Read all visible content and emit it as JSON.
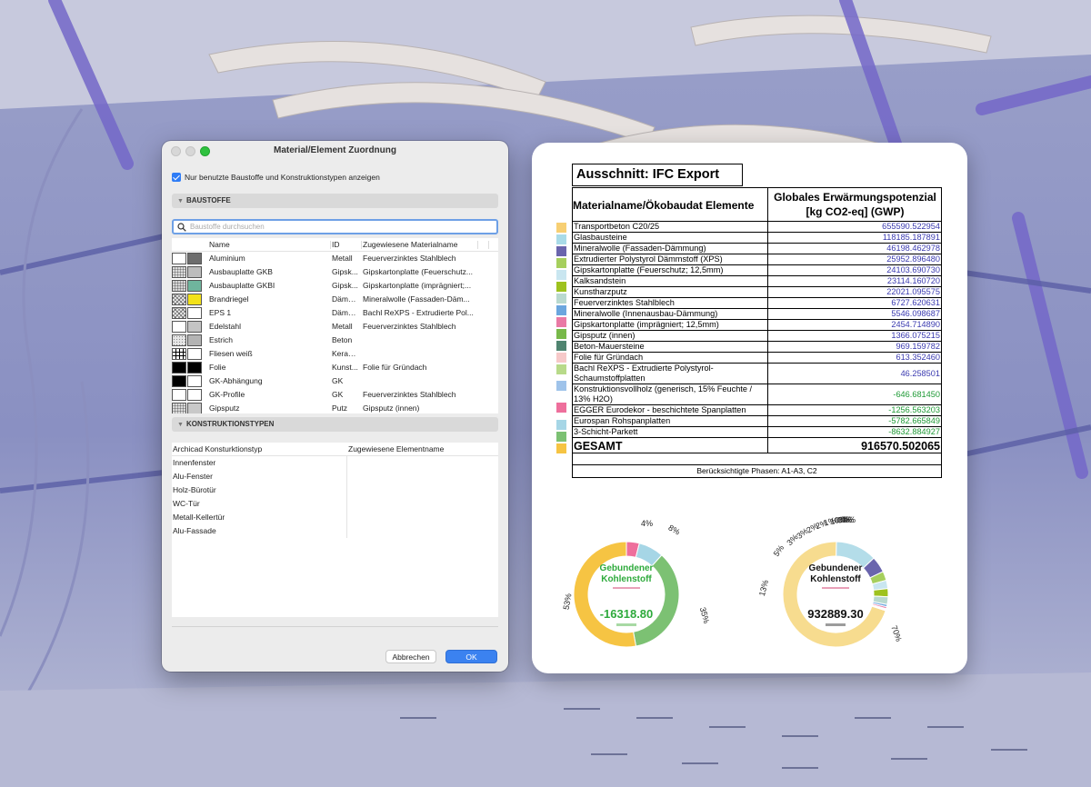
{
  "dialog": {
    "title": "Material/Element Zuordnung",
    "checkbox_label": "Nur benutzte Baustoffe und Konstruktionstypen anzeigen",
    "baustoffe_header": "BAUSTOFFE",
    "search_placeholder": "Baustoffe durchsuchen",
    "columns": {
      "name": "Name",
      "id": "ID",
      "assigned": "Zugewiesene Materialname"
    },
    "materials": [
      {
        "name": "Aluminium",
        "id": "Metall",
        "assigned": "Feuerverzinktes Stahlblech",
        "sw1": "#ffffff",
        "sw2": "#6d6d6d",
        "pattern": "none"
      },
      {
        "name": "Ausbauplatte GKB",
        "id": "Gipsk...",
        "assigned": "Gipskartonplatte (Feuerschutz...",
        "sw1": "#dcdcdc",
        "sw2": "#bcbcbc",
        "pattern": "grid"
      },
      {
        "name": "Ausbauplatte GKBI",
        "id": "Gipsk...",
        "assigned": "Gipskartonplatte (imprägniert;...",
        "sw1": "#d6d6d6",
        "sw2": "#6fb59d",
        "pattern": "grid"
      },
      {
        "name": "Brandriegel",
        "id": "Dämm...",
        "assigned": "Mineralwolle (Fassaden-Däm...",
        "sw1": "#ececec",
        "sw2": "#f3e21a",
        "pattern": "wave"
      },
      {
        "name": "EPS 1",
        "id": "Dämm...",
        "assigned": "Bachl ReXPS - Extrudierte Pol...",
        "sw1": "#ececec",
        "sw2": "#ffffff",
        "pattern": "wave"
      },
      {
        "name": "Edelstahl",
        "id": "Metall",
        "assigned": "Feuerverzinktes Stahlblech",
        "sw1": "#ffffff",
        "sw2": "#c4c4c4",
        "pattern": "none"
      },
      {
        "name": "Estrich",
        "id": "Beton",
        "assigned": "",
        "sw1": "#e6e6e6",
        "sw2": "#b4b4b4",
        "pattern": "dots"
      },
      {
        "name": "Fliesen weiß",
        "id": "Keram...",
        "assigned": "",
        "sw1": "#ffffff",
        "sw2": "#ffffff",
        "pattern": "tile"
      },
      {
        "name": "Folie",
        "id": "Kunst...",
        "assigned": "Folie für Gründach",
        "sw1": "#000000",
        "sw2": "#000000",
        "pattern": "none"
      },
      {
        "name": "GK-Abhängung",
        "id": "GK",
        "assigned": "",
        "sw1": "#000000",
        "sw2": "#ffffff",
        "pattern": "none"
      },
      {
        "name": "GK-Profile",
        "id": "GK",
        "assigned": "Feuerverzinktes Stahlblech",
        "sw1": "#ffffff",
        "sw2": "#ffffff",
        "pattern": "none"
      },
      {
        "name": "Gipsputz",
        "id": "Putz",
        "assigned": "Gipsputz (innen)",
        "sw1": "#dadada",
        "sw2": "#c8c8c8",
        "pattern": "grid"
      }
    ],
    "konstruktion_header": "KONSTRUKTIONSTYPEN",
    "kon_columns": {
      "type": "Archicad Konsturktionstyp",
      "element": "Zugewiesene Elementname"
    },
    "konstruktionstypen": [
      "Innenfenster",
      "Alu-Fenster",
      "Holz-Bürotür",
      "WC-Tür",
      "Metall-Kellertür",
      "Alu-Fassade"
    ],
    "cancel_label": "Abbrechen",
    "ok_label": "OK"
  },
  "report": {
    "title": "Ausschnitt: IFC Export",
    "col_name": "Materialname/Ökobaudat Elemente",
    "col_gwp_line1": "Globales Erwärmungspotenzial",
    "col_gwp_line2": "[kg CO2-eq] (GWP)",
    "rows": [
      {
        "name": "Transportbeton C20/25",
        "value": "655590.522954",
        "color": "#f7cf73",
        "lines": 1
      },
      {
        "name": "Glasbausteine",
        "value": "118185.187891",
        "color": "#a9dbe8",
        "lines": 1
      },
      {
        "name": "Mineralwolle (Fassaden-Dämmung)",
        "value": "46198.462978",
        "color": "#6a65ad",
        "lines": 1
      },
      {
        "name": "Extrudierter Polystyrol Dämmstoff (XPS)",
        "value": "25952.896480",
        "color": "#a6cf5d",
        "lines": 1
      },
      {
        "name": "Gipskartonplatte (Feuerschutz; 12,5mm)",
        "value": "24103.690730",
        "color": "#c9e6f0",
        "lines": 1
      },
      {
        "name": "Kalksandstein",
        "value": "23114.160720",
        "color": "#9ec21e",
        "lines": 1
      },
      {
        "name": "Kunstharzputz",
        "value": "22021.095575",
        "color": "#b9d9cf",
        "lines": 1
      },
      {
        "name": "Feuerverzinktes Stahlblech",
        "value": "6727.620631",
        "color": "#6ba6de",
        "lines": 1
      },
      {
        "name": "Mineralwolle (Innenausbau-Dämmung)",
        "value": "5546.098687",
        "color": "#e97aa5",
        "lines": 1
      },
      {
        "name": "Gipskartonplatte (imprägniert; 12,5mm)",
        "value": "2454.714890",
        "color": "#78b94a",
        "lines": 1
      },
      {
        "name": "Gipsputz (innen)",
        "value": "1366.075215",
        "color": "#4f8470",
        "lines": 1
      },
      {
        "name": "Beton-Mauersteine",
        "value": "969.159782",
        "color": "#f6c9c9",
        "lines": 1
      },
      {
        "name": "Folie für Gründach",
        "value": "613.352460",
        "color": "#b8da8a",
        "lines": 1
      },
      {
        "name": "Bachl ReXPS - Extrudierte Polystyrol-Schaumstoffplatten",
        "value": "46.258501",
        "color": "#9fc3ea",
        "lines": 2
      },
      {
        "name": "Konstruktionsvollholz (generisch, 15% Feuchte / 13% H2O)",
        "value": "-646.681450",
        "color": "#ee6f9c",
        "lines": 2,
        "neg": true
      },
      {
        "name": "EGGER Eurodekor - beschichtete Spanplatten",
        "value": "-1256.563203",
        "color": "#a6d6e6",
        "lines": 1,
        "neg": true
      },
      {
        "name": "Eurospan Rohspanplatten",
        "value": "-5782.665849",
        "color": "#7cc173",
        "lines": 1,
        "neg": true
      },
      {
        "name": "3-Schicht-Parkett",
        "value": "-8632.884927",
        "color": "#f6c443",
        "lines": 1,
        "neg": true
      }
    ],
    "total_label": "GESAMT",
    "total_value": "916570.502065",
    "phases": "Berücksichtigte Phasen: A1-A3, C2"
  },
  "chart_data": [
    {
      "type": "pie",
      "donut": true,
      "title": "Gebundener Kohlenstoff",
      "center_value": "-16318.80",
      "labels": [
        "Konstruktionsvollholz (generisch, 15% Feuchte / 13% H2O)",
        "EGGER Eurodekor - beschichtete Spanplatten",
        "Eurospan Rohspanplatten",
        "3-Schicht-Parkett"
      ],
      "values": [
        646.68,
        1256.56,
        5782.67,
        8632.88
      ],
      "colors": [
        "#ee6f9c",
        "#a6d6e6",
        "#7cc173",
        "#f6c443"
      ],
      "percent_labels": [
        "4%",
        "8%",
        "35%",
        "53%"
      ]
    },
    {
      "type": "pie",
      "donut": true,
      "title": "Gebundener Kohlenstoff",
      "center_value": "932889.30",
      "labels": [
        "Transportbeton C20/25",
        "Glasbausteine",
        "Mineralwolle (Fassaden-Dämmung)",
        "Extrudierter Polystyrol Dämmstoff (XPS)",
        "Gipskartonplatte (Feuerschutz; 12,5mm)",
        "Kalksandstein",
        "Kunstharzputz",
        "Feuerverzinktes Stahlblech",
        "Mineralwolle (Innenausbau-Dämmung)",
        "Gipskartonplatte (imprägniert; 12,5mm)",
        "Gipsputz (innen)",
        "Beton-Mauersteine",
        "Folie für Gründach",
        "Bachl ReXPS - Extrudierte Polystyrol-Schaumstoffplatten"
      ],
      "values": [
        655590.52,
        118185.19,
        46198.46,
        25952.9,
        24103.69,
        23114.16,
        22021.1,
        6727.62,
        5546.1,
        2454.71,
        1366.08,
        969.16,
        613.35,
        46.26
      ],
      "colors": [
        "#f7dc8f",
        "#b4dde9",
        "#6a65ad",
        "#a6cf5d",
        "#c9e6f0",
        "#9ec21e",
        "#b9d9cf",
        "#6ba6de",
        "#e97aa5",
        "#78b94a",
        "#4f8470",
        "#f6c9c9",
        "#b8da8a",
        "#9fc3ea"
      ],
      "percent_labels": [
        "70%",
        "13%",
        "5%",
        "3%",
        "3%",
        "2%",
        "2%",
        "1%",
        "1%",
        "0%",
        "0%",
        "0%",
        "0%",
        "0%"
      ]
    }
  ]
}
